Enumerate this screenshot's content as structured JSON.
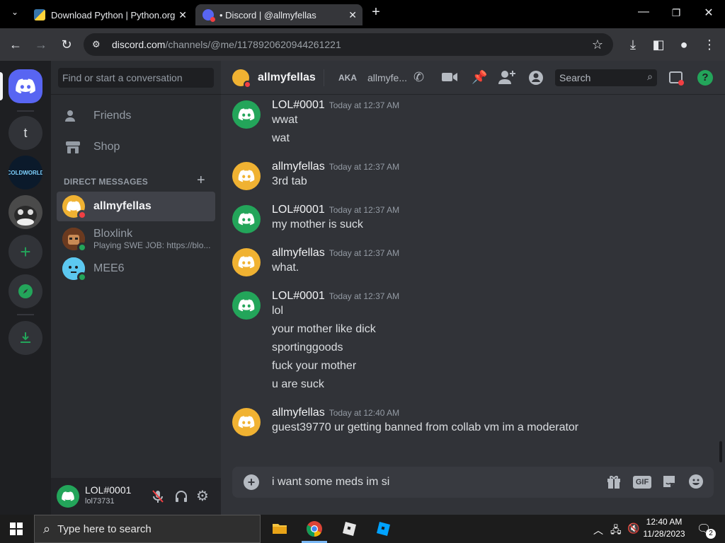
{
  "browser": {
    "tabs": [
      {
        "title": "Download Python | Python.org",
        "active": false
      },
      {
        "title": "• Discord | @allmyfellas",
        "active": true
      }
    ],
    "url_host": "discord.com",
    "url_path": "/channels/@me/1178920620944261221"
  },
  "sidebar": {
    "search_placeholder": "Find or start a conversation",
    "nav": [
      {
        "label": "Friends",
        "icon": "friends-icon"
      },
      {
        "label": "Shop",
        "icon": "shop-icon"
      }
    ],
    "dm_header": "DIRECT MESSAGES",
    "dms": [
      {
        "name": "allmyfellas",
        "subtitle": "",
        "status": "dnd",
        "selected": true
      },
      {
        "name": "Bloxlink",
        "subtitle": "Playing SWE JOB: https://blo...",
        "status": "online",
        "selected": false
      },
      {
        "name": "MEE6",
        "subtitle": "",
        "status": "online",
        "selected": false
      }
    ]
  },
  "servers": [
    {
      "name": "home",
      "letter": ""
    },
    {
      "name": "t",
      "letter": "t"
    },
    {
      "name": "coldworld",
      "letter": "COLDWORLD"
    },
    {
      "name": "avatar-server",
      "letter": ""
    }
  ],
  "user": {
    "name": "LOL#0001",
    "tag": "lol73731"
  },
  "header": {
    "name": "allmyfellas",
    "aka": "AKA",
    "aka_name": "allmyfe...",
    "search_placeholder": "Search"
  },
  "messages": [
    {
      "author": "LOL#0001",
      "time": "Today at 12:37 AM",
      "avatar_color": "#23a55a",
      "lines": [
        "wwat",
        "wat"
      ]
    },
    {
      "author": "allmyfellas",
      "time": "Today at 12:37 AM",
      "avatar_color": "#f0b232",
      "lines": [
        "3rd tab"
      ]
    },
    {
      "author": "LOL#0001",
      "time": "Today at 12:37 AM",
      "avatar_color": "#23a55a",
      "lines": [
        "my mother is suck"
      ]
    },
    {
      "author": "allmyfellas",
      "time": "Today at 12:37 AM",
      "avatar_color": "#f0b232",
      "lines": [
        "what."
      ]
    },
    {
      "author": "LOL#0001",
      "time": "Today at 12:37 AM",
      "avatar_color": "#23a55a",
      "lines": [
        "lol",
        "your mother like dick",
        "sportinggoods",
        "fuck your mother",
        "u are suck"
      ]
    },
    {
      "author": "allmyfellas",
      "time": "Today at 12:40 AM",
      "avatar_color": "#f0b232",
      "lines": [
        "guest39770 ur getting banned from collab vm im a moderator"
      ]
    }
  ],
  "composer": {
    "text": "i want some meds im si",
    "gif_label": "GIF"
  },
  "taskbar": {
    "search_placeholder": "Type here to search",
    "time": "12:40 AM",
    "date": "11/28/2023",
    "notification_count": "2"
  },
  "colors": {
    "blurple": "#5865f2",
    "green": "#23a55a",
    "yellow": "#f0b232",
    "dnd_red": "#f23f43"
  }
}
